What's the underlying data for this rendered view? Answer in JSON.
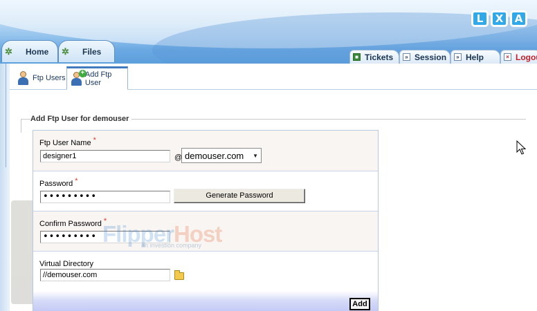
{
  "header": {
    "logo_letters": [
      "L",
      "X",
      "A"
    ],
    "main_tabs": [
      {
        "label": "Home"
      },
      {
        "label": "Files"
      }
    ],
    "right_tabs": [
      {
        "label": "Tickets"
      },
      {
        "label": "Session"
      },
      {
        "label": "Help"
      },
      {
        "label": "Logou"
      }
    ]
  },
  "subtabs": [
    {
      "label": "Ftp Users"
    },
    {
      "label": "Add Ftp User"
    }
  ],
  "form": {
    "legend": "Add Ftp User for demouser",
    "username_label": "Ftp User Name",
    "username_value": "designer1",
    "at_sign": "@",
    "domain_selected": "demouser.com",
    "password_label": "Password",
    "password_value": "•••••••••",
    "generate_button": "Generate Password",
    "confirm_label": "Confirm Password",
    "confirm_value": "•••••••••",
    "vdir_label": "Virtual Directory",
    "vdir_value": "//demouser.com",
    "add_button": "Add",
    "required_mark": "*"
  },
  "watermark": {
    "brand_part1": "Flipper",
    "brand_part2": "Host",
    "tagline": "an investion company"
  },
  "colors": {
    "header_blue": "#6aa9e2",
    "logo_blue": "#31a8e8",
    "required_red": "#e0342c",
    "logout_red": "#c2202a"
  }
}
